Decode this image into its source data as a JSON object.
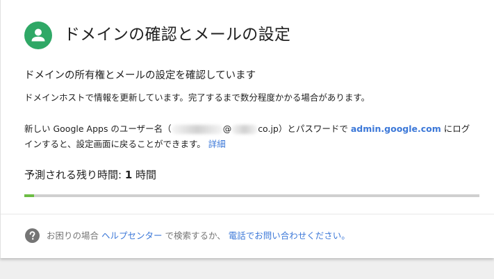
{
  "header": {
    "title": "ドメインの確認とメールの設定",
    "icon": "person-icon",
    "icon_color": "#2fa866"
  },
  "status": {
    "subtitle": "ドメインの所有権とメールの設定を確認しています",
    "host_message": "ドメインホストで情報を更新しています。完了するまで数分程度かかる場合があります。"
  },
  "login": {
    "prefix": "新しい Google Apps のユーザー名（",
    "at": "@",
    "domain_suffix": "co.jp）とパスワードで ",
    "admin_link": "admin.google.com",
    "middle": " にログインすると、設定画面に戻ることができます。 ",
    "details_link": "詳細"
  },
  "progress": {
    "label": "予測される残り時間: ",
    "value": "1",
    "unit": " 時間",
    "fraction": 0.022,
    "color": "#6cbd45"
  },
  "help": {
    "icon": "help-icon",
    "prefix": "お困りの場合 ",
    "help_center_link": "ヘルプセンター",
    "middle": " で検索するか、 ",
    "contact_link": "電話でお問い合わせください。"
  },
  "colors": {
    "link": "#3c78d8",
    "text": "#212121",
    "muted": "#757575"
  }
}
